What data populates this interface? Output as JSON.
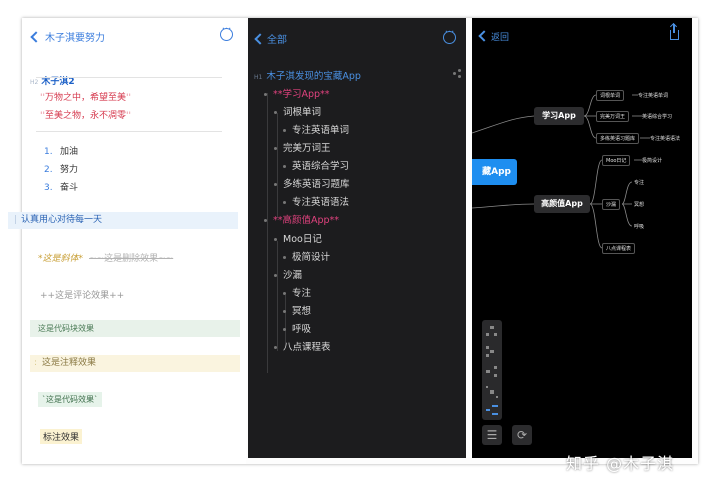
{
  "panel_light": {
    "back_label": "木子淇要努力",
    "heading": "木子淇2",
    "heading_marker": "H2",
    "quote_line1": "万物之中，希望至美",
    "quote_line2": "至美之物，永不凋零",
    "ordered_list": [
      {
        "num": "1.",
        "text": "加油"
      },
      {
        "num": "2.",
        "text": "努力"
      },
      {
        "num": "3.",
        "text": "奋斗"
      }
    ],
    "blockquote": "认真用心对待每一天",
    "italic_text": "这是斜体",
    "strike_text": "~~这是删除效果~~",
    "comment_text": "++这是评论效果++",
    "codeblock_text": "这是代码块效果",
    "note_text": "这是注释效果",
    "inline_code_text": "`这是代码效果`",
    "mark_text": "标注效果"
  },
  "panel_outline": {
    "back_label": "全部",
    "title": "木子淇发现的宝藏App",
    "title_marker": "H1",
    "items": [
      {
        "text": "**学习App**",
        "style": "pink"
      },
      {
        "text": "词根单词",
        "style": "normal"
      },
      {
        "text": "专注英语单词",
        "style": "normal"
      },
      {
        "text": "完美万词王",
        "style": "normal"
      },
      {
        "text": "英语综合学习",
        "style": "normal"
      },
      {
        "text": "多练英语习题库",
        "style": "normal"
      },
      {
        "text": "专注英语语法",
        "style": "normal"
      },
      {
        "text": "**高颜值App**",
        "style": "pink"
      },
      {
        "text": "Moo日记",
        "style": "normal"
      },
      {
        "text": "极简设计",
        "style": "normal"
      },
      {
        "text": "沙漏",
        "style": "normal"
      },
      {
        "text": "专注",
        "style": "normal"
      },
      {
        "text": "冥想",
        "style": "normal"
      },
      {
        "text": "呼吸",
        "style": "normal"
      },
      {
        "text": "八点课程表",
        "style": "normal"
      }
    ]
  },
  "panel_mindmap": {
    "back_label": "返回",
    "root_label": "藏App",
    "branch1": "学习App",
    "branch1_children": [
      {
        "box": "词根单词",
        "leaf": "专注英语单词"
      },
      {
        "box": "完美万词王",
        "leaf": "英语综合学习"
      },
      {
        "box": "多练英语习题库",
        "leaf": "专注英语语法"
      }
    ],
    "branch2": "高颜值App",
    "b2_moo": "Moo日记",
    "b2_moo_leaf": "极简设计",
    "b2_sand": "沙漏",
    "b2_sand_leaves": [
      "专注",
      "冥想",
      "呼吸"
    ],
    "b2_course": "八点课程表"
  },
  "watermark": "知乎 @木子淇",
  "colors": {
    "accent_blue": "#3b7ddd",
    "pink": "#e0427e",
    "root_blue": "#1e8ef0"
  }
}
